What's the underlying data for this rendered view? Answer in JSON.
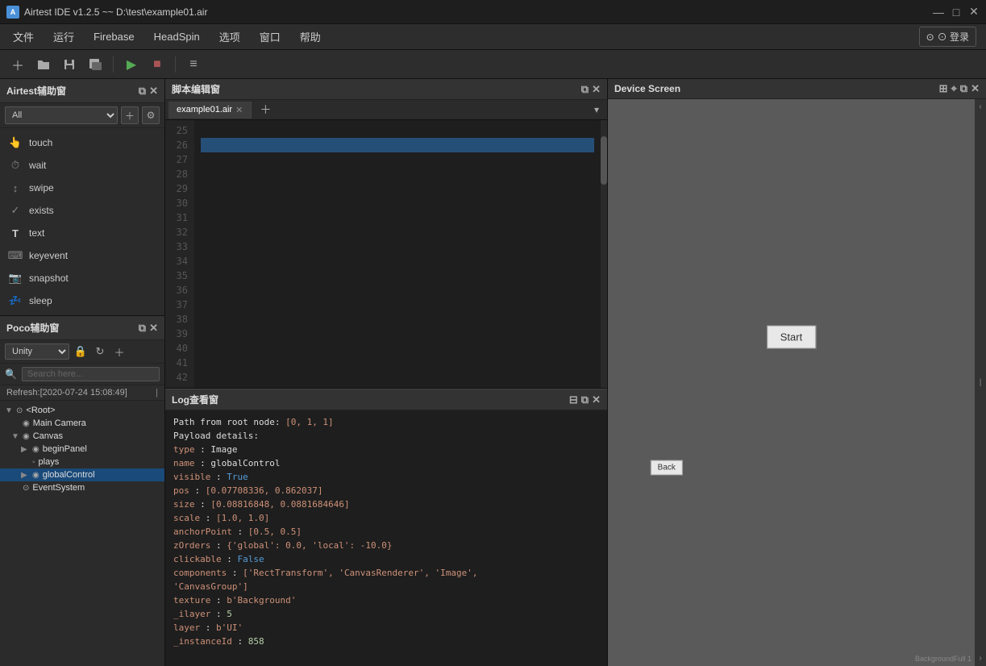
{
  "titlebar": {
    "title": "Airtest IDE v1.2.5  ~~  D:\\test\\example01.air",
    "icon_label": "A",
    "min": "—",
    "max": "□",
    "close": "✕"
  },
  "menubar": {
    "items": [
      "文件",
      "运行",
      "Firebase",
      "HeadSpin",
      "选项",
      "窗口",
      "帮助"
    ],
    "login_label": "⊙ 登录"
  },
  "toolbar": {
    "buttons": [
      "＋",
      "📁",
      "💾",
      "💾",
      "▶",
      "■",
      "≡"
    ]
  },
  "airtest_panel": {
    "title": "Airtest辅助窗",
    "filter_default": "All",
    "items": [
      {
        "icon": "👆",
        "label": "touch"
      },
      {
        "icon": "⏱",
        "label": "wait"
      },
      {
        "icon": "↕",
        "label": "swipe"
      },
      {
        "icon": "✓",
        "label": "exists"
      },
      {
        "icon": "T",
        "label": "text"
      },
      {
        "icon": "⌨",
        "label": "keyevent"
      },
      {
        "icon": "📷",
        "label": "snapshot"
      },
      {
        "icon": "💤",
        "label": "sleep"
      }
    ]
  },
  "poco_panel": {
    "title": "Poco辅助窗",
    "engine": "Unity",
    "search_placeholder": "Search here...",
    "refresh_label": "Refresh:[2020-07-24 15:08:49]",
    "tree": [
      {
        "indent": 0,
        "expand": "▼",
        "icon": "⊙",
        "label": "<Root>"
      },
      {
        "indent": 1,
        "expand": " ",
        "icon": "◉",
        "label": "Main Camera"
      },
      {
        "indent": 1,
        "expand": "▼",
        "icon": "◉",
        "label": "Canvas"
      },
      {
        "indent": 2,
        "expand": "▶",
        "icon": "◉",
        "label": "beginPanel"
      },
      {
        "indent": 2,
        "expand": " ",
        "icon": "◦",
        "label": "plays"
      },
      {
        "indent": 2,
        "expand": "▶",
        "icon": "◉",
        "label": "globalControl",
        "selected": true
      },
      {
        "indent": 1,
        "expand": " ",
        "icon": "⊙",
        "label": "EventSystem"
      }
    ]
  },
  "script_editor": {
    "title": "脚本编辑窗",
    "tab_label": "example01.air",
    "line_start": 25,
    "line_end": 42,
    "lines": [
      25,
      26,
      27,
      28,
      29,
      30,
      31,
      32,
      33,
      34,
      35,
      36,
      37,
      38,
      39,
      40,
      41,
      42
    ]
  },
  "log_viewer": {
    "title": "Log查看窗",
    "path_line": "Path from root node: [0, 1, 1]",
    "payload_label": "Payload details:",
    "entries": [
      {
        "key": "    type",
        "sep": " : ",
        "val": "Image",
        "val_type": "white"
      },
      {
        "key": "    name",
        "sep": " :  ",
        "val": "globalControl",
        "val_type": "white"
      },
      {
        "key": "    visible",
        "sep": " : ",
        "val": "True",
        "val_type": "bool"
      },
      {
        "key": "    pos",
        "sep": " : ",
        "val": "[0.07708336, 0.862037]",
        "val_type": "list"
      },
      {
        "key": "    size",
        "sep": " : ",
        "val": "[0.08816848, 0.0881684646]",
        "val_type": "list"
      },
      {
        "key": "    scale",
        "sep": " : ",
        "val": "[1.0, 1.0]",
        "val_type": "list"
      },
      {
        "key": "    anchorPoint",
        "sep": " : ",
        "val": "[0.5, 0.5]",
        "val_type": "list"
      },
      {
        "key": "    zOrders",
        "sep": " : ",
        "val": "{'global': 0.0, 'local': -10.0}",
        "val_type": "dict"
      },
      {
        "key": "    clickable",
        "sep": " : ",
        "val": "False",
        "val_type": "bool"
      },
      {
        "key": "    components",
        "sep": " : ",
        "val": "['RectTransform', 'CanvasRenderer', 'Image',",
        "val_type": "list"
      },
      {
        "key": "'CanvasGroup']",
        "sep": "",
        "val": "",
        "val_type": "white"
      },
      {
        "key": "        texture",
        "sep": " : ",
        "val": "b'Background'",
        "val_type": "bytes"
      },
      {
        "key": "        _ilayer",
        "sep": " : ",
        "val": "5",
        "val_type": "num"
      },
      {
        "key": "        layer",
        "sep": " : ",
        "val": "b'UI'",
        "val_type": "bytes"
      },
      {
        "key": "        _instanceId",
        "sep": " : ",
        "val": "858",
        "val_type": "num"
      }
    ]
  },
  "device_screen": {
    "title": "Device Screen",
    "start_btn": "Start",
    "back_btn": "Back",
    "watermark": "BackgroundFull 1"
  }
}
